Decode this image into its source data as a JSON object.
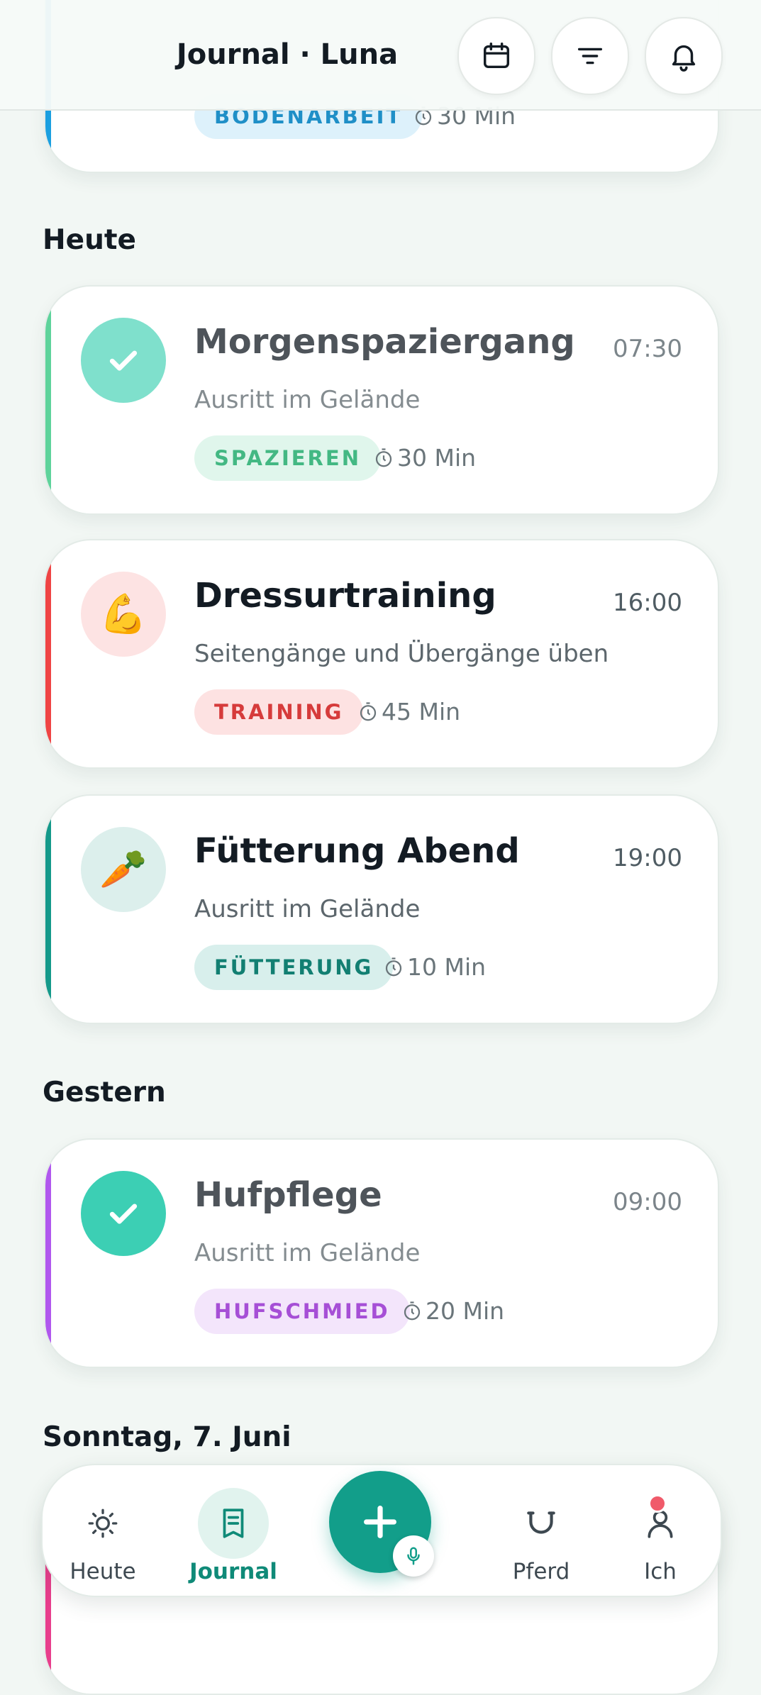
{
  "header": {
    "title": "Journal · Luna",
    "buttons": [
      {
        "name": "calendar-button",
        "icon": "calendar-icon"
      },
      {
        "name": "filter-button",
        "icon": "filter-icon"
      },
      {
        "name": "notifications-button",
        "icon": "bell-icon"
      }
    ]
  },
  "partial_card": {
    "tag": "BODENARBEIT",
    "duration": "30 Min",
    "stripe_color": "#1a9fe0",
    "tag_bg": "#ddf1fb",
    "tag_color": "#1f8fc7"
  },
  "sections": [
    {
      "label": "Heute",
      "entries": [
        {
          "title": "Morgenspaziergang",
          "time": "07:30",
          "subtitle": "Ausritt im Gelände",
          "tag": "SPAZIEREN",
          "duration": "30 Min",
          "done": true,
          "icon": "check-icon",
          "stripe_color": "#5ed39b",
          "icon_bg": "#7fe0cc",
          "tag_bg": "#e0f6ec",
          "tag_color": "#43b883"
        },
        {
          "title": "Dressurtraining",
          "time": "16:00",
          "subtitle": "Seitengänge und Übergänge üben",
          "tag": "TRAINING",
          "duration": "45 Min",
          "done": false,
          "icon": "flexed-biceps-icon",
          "emoji": "💪",
          "stripe_color": "#ef4444",
          "icon_bg": "#fde3e3",
          "tag_bg": "#fde2e2",
          "tag_color": "#d63b3b"
        },
        {
          "title": "Fütterung Abend",
          "time": "19:00",
          "subtitle": "Ausritt im Gelände",
          "tag": "FÜTTERUNG",
          "duration": "10 Min",
          "done": false,
          "icon": "carrot-icon",
          "emoji": "🥕",
          "stripe_color": "#14998a",
          "icon_bg": "#dcefec",
          "tag_bg": "#d8efec",
          "tag_color": "#127f72"
        }
      ]
    },
    {
      "label": "Gestern",
      "entries": [
        {
          "title": "Hufpflege",
          "time": "09:00",
          "subtitle": "Ausritt im Gelände",
          "tag": "HUFSCHMIED",
          "duration": "20 Min",
          "done": true,
          "icon": "check-icon",
          "stripe_color": "#b057ee",
          "icon_bg": "#3ccfb4",
          "tag_bg": "#f3e5fb",
          "tag_color": "#a64fd6"
        }
      ]
    },
    {
      "label": "Sonntag, 7. Juni",
      "entries": []
    }
  ],
  "nav": {
    "items": [
      {
        "label": "Heute",
        "icon": "sun-icon",
        "active": false
      },
      {
        "label": "Journal",
        "icon": "journal-icon",
        "active": true
      },
      {
        "label": "Pferd",
        "icon": "horseshoe-icon",
        "active": false
      },
      {
        "label": "Ich",
        "icon": "person-icon",
        "active": false
      }
    ],
    "fab_icon": "plus-icon",
    "mic_icon": "microphone-icon",
    "accent": "#129e8a"
  }
}
